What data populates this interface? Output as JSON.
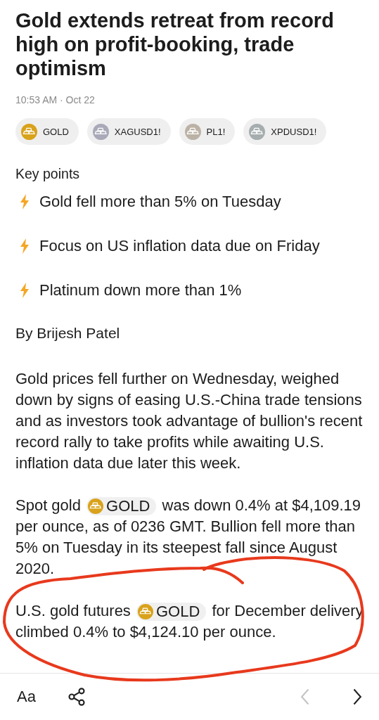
{
  "article": {
    "title": "Gold extends retreat from record high on profit-booking, trade optimism",
    "timestamp": "10:53 AM · Oct 22",
    "tickers": [
      {
        "symbol": "GOLD",
        "color": "#d9a21b"
      },
      {
        "symbol": "XAGUSD1!",
        "color": "#a9a9b9"
      },
      {
        "symbol": "PL1!",
        "color": "#bbb2a5"
      },
      {
        "symbol": "XPDUSD1!",
        "color": "#a5adae"
      }
    ],
    "key_points_heading": "Key points",
    "key_points": [
      "Gold fell more than 5% on Tuesday",
      "Focus on US inflation data due on Friday",
      "Platinum down more than 1%"
    ],
    "byline": "By Brijesh Patel",
    "paragraphs": [
      {
        "parts": [
          {
            "kind": "text",
            "text": "Gold prices fell further on Wednesday, weighed down by signs of easing U.S.-China trade tensions and as investors took advantage of bullion's recent record rally to take profits while awaiting U.S. inflation data due later this week."
          }
        ]
      },
      {
        "parts": [
          {
            "kind": "text",
            "text": "Spot gold "
          },
          {
            "kind": "ticker",
            "text": "GOLD",
            "color": "#d9a21b"
          },
          {
            "kind": "text",
            "text": " was down 0.4% at $4,109.19 per ounce, as of 0236 GMT. Bullion fell more than 5% on Tuesday in its steepest fall since August 2020."
          }
        ]
      },
      {
        "parts": [
          {
            "kind": "text",
            "text": "U.S. gold futures "
          },
          {
            "kind": "ticker",
            "text": "GOLD",
            "color": "#d9a21b"
          },
          {
            "kind": "text",
            "text": " for December delivery climbed 0.4% to $4,124.10 per ounce."
          }
        ]
      }
    ]
  },
  "toolbar": {
    "font_size_label": "Aa",
    "previous_disabled": true,
    "next_disabled": false
  },
  "annotation": {
    "color": "#e8391d"
  }
}
